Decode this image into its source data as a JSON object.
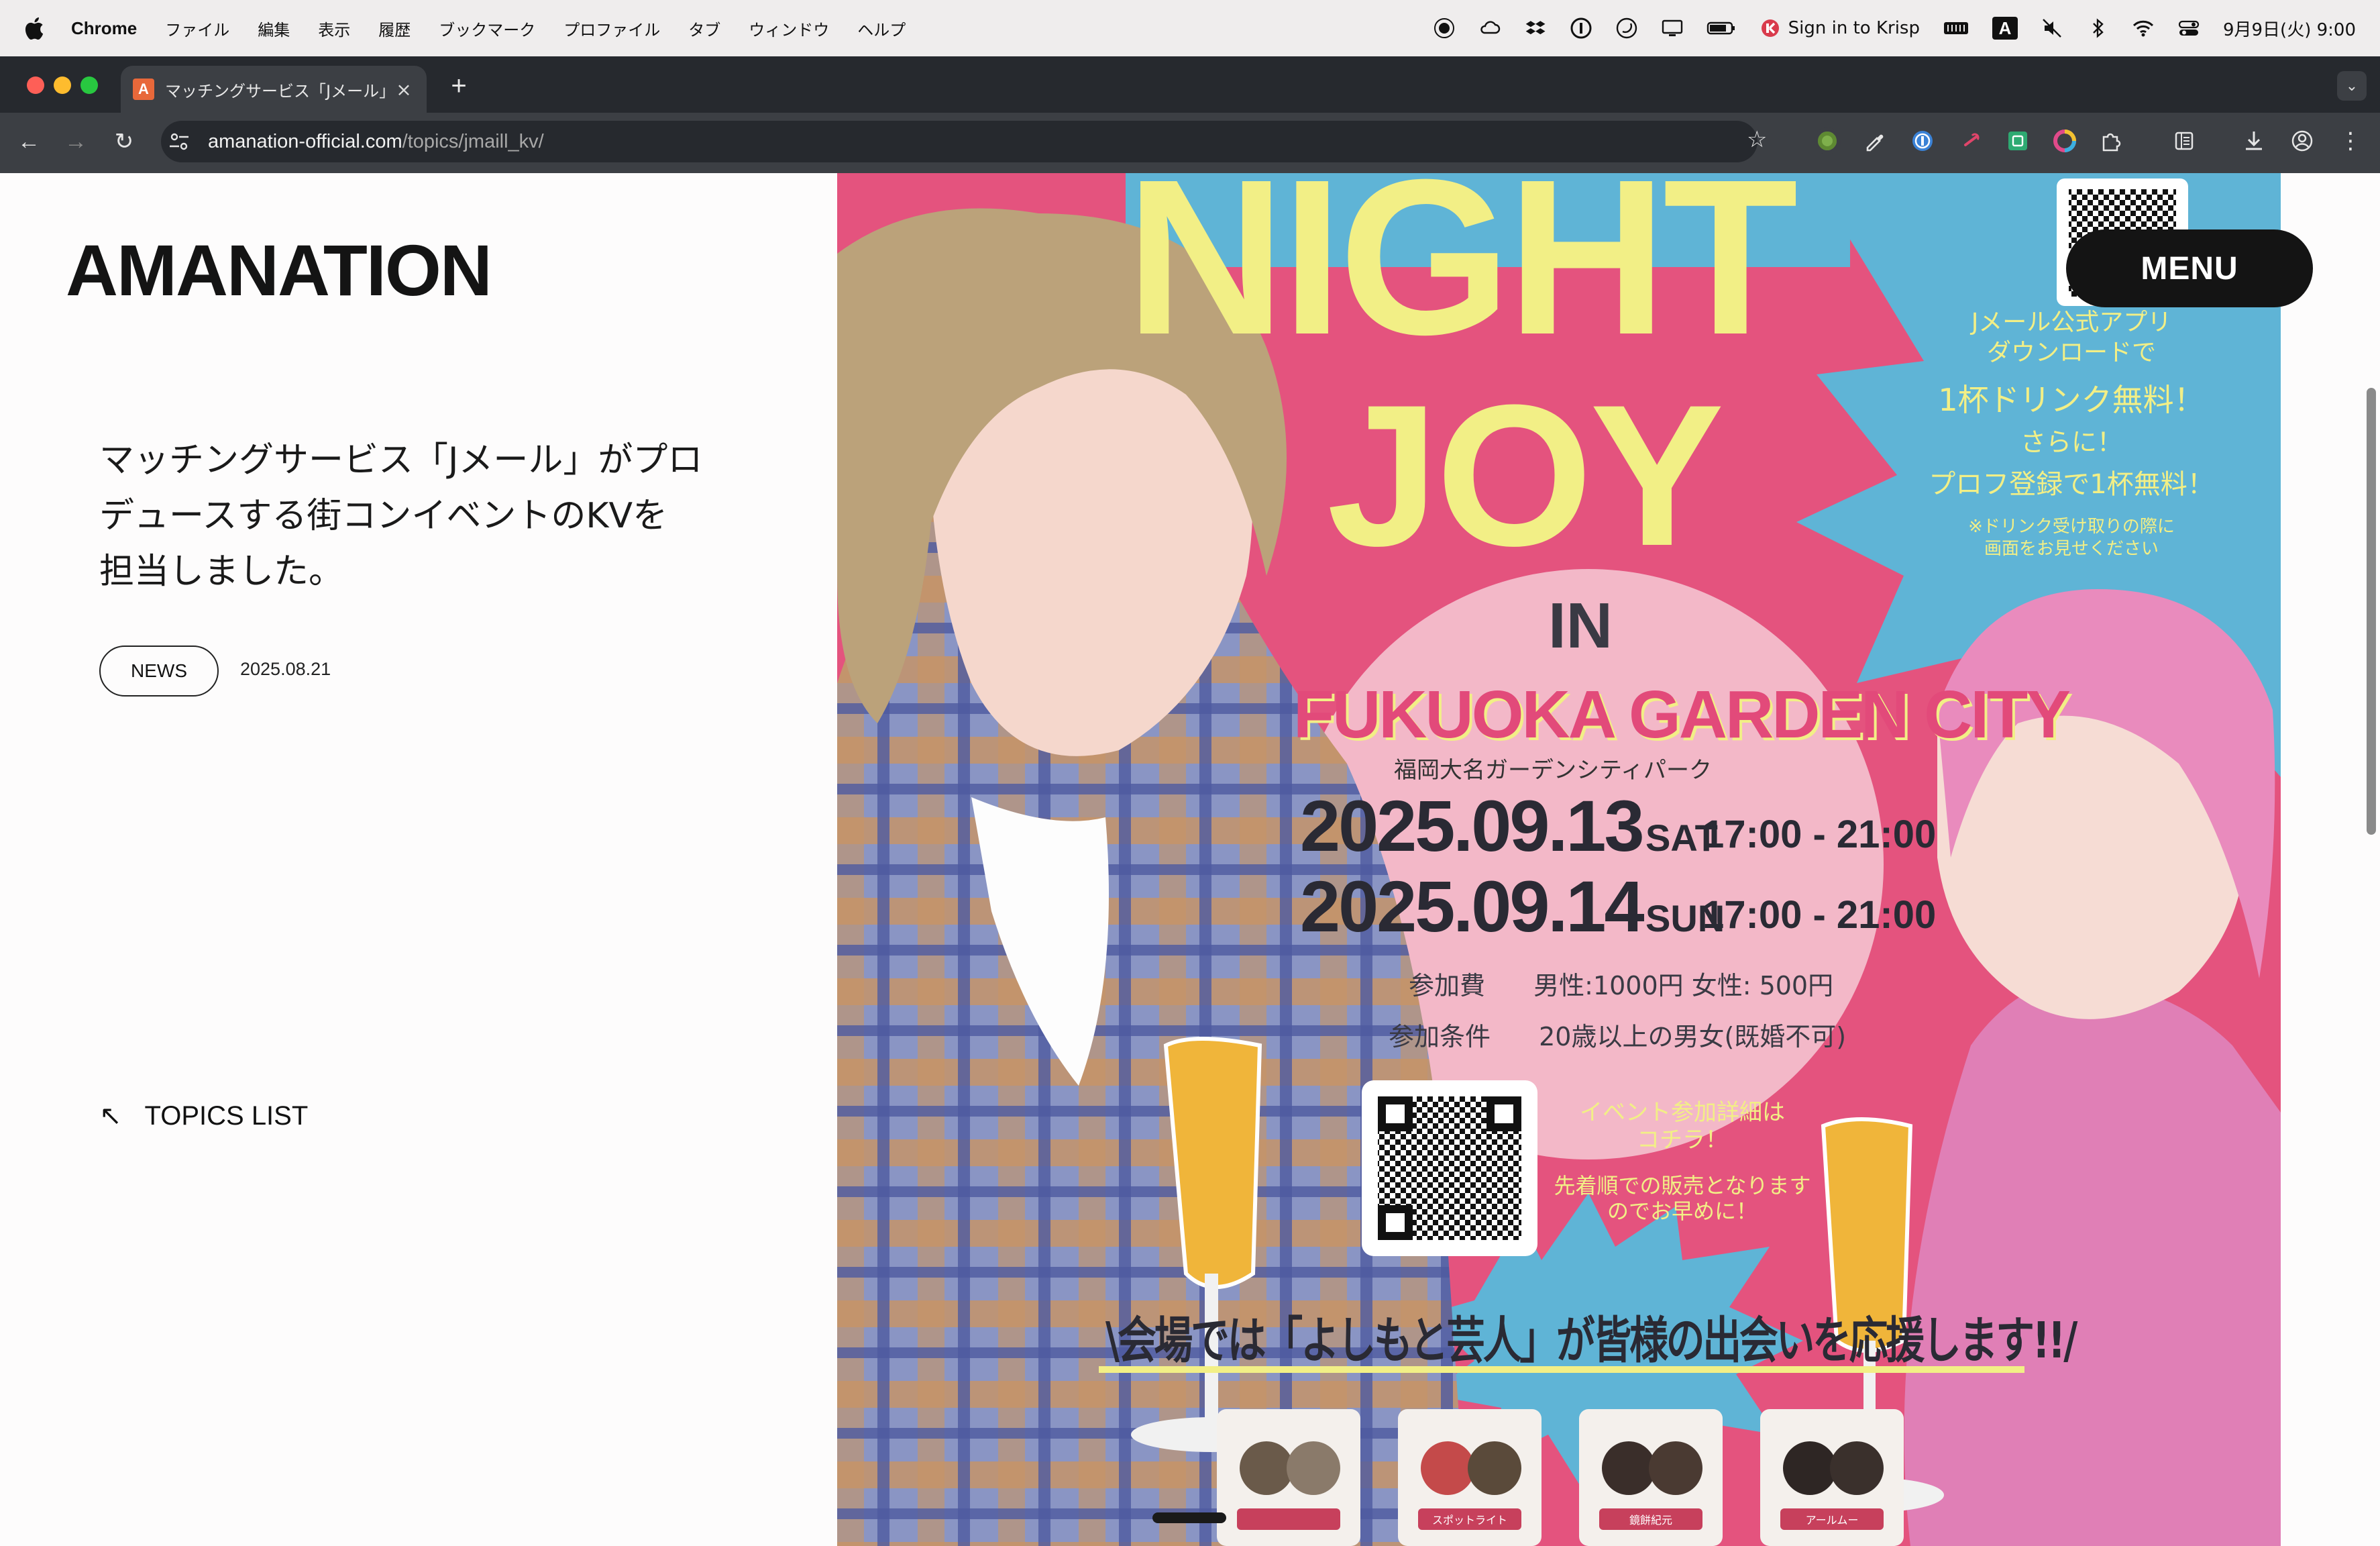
{
  "system_menubar": {
    "app_name": "Chrome",
    "menus": [
      "ファイル",
      "編集",
      "表示",
      "履歴",
      "ブックマーク",
      "プロファイル",
      "タブ",
      "ウィンドウ",
      "ヘルプ"
    ],
    "krisp_label": "Sign in to Krisp",
    "keyboard_indicator": "A",
    "clock": "9月9日(火) 9:00"
  },
  "browser": {
    "tab_title": "マッチングサービス「Jメール」/",
    "favicon_letter": "A",
    "url_host": "amanation-official.com",
    "url_path": "/topics/jmaill_kv/"
  },
  "page": {
    "logo": "AMANATION",
    "headline_lines": [
      "マッチングサービス「Jメール」がプロ",
      "デュースする街コンイベントのKVを",
      "担当しました。"
    ],
    "category_tag": "NEWS",
    "date": "2025.08.21",
    "topics_list_label": "TOPICS LIST",
    "menu_label": "MENU"
  },
  "poster": {
    "title_line1": "NIGHT",
    "title_line2": "JOY",
    "in_label": "IN",
    "venue_en": "FUKUOKA GARDEN CITY",
    "venue_ja": "福岡大名ガーデンシティパーク",
    "date1": "2025.09.13",
    "day1": "SAT",
    "date2": "2025.09.14",
    "day2": "SUN",
    "time": "17:00 - 21:00",
    "fee_label": "参加費",
    "fee_value": "男性:1000円  女性: 500円",
    "condition_label": "参加条件",
    "condition_value": "20歳以上の男女(既婚不可)",
    "promo_lines": [
      "Jメール公式アプリ",
      "ダウンロードで",
      "1杯ドリンク無料！",
      "さらに！",
      "プロフ登録で1杯無料！",
      "※ドリンク受け取りの際に",
      "画面をお見せください"
    ],
    "details_lines": [
      "イベント参加詳細は",
      "コチラ！",
      "先着順での販売となります",
      "のでお早めに！"
    ],
    "banner": "\\会場では「よしもと芸人」が皆様の出会いを応援します!!/",
    "performers": [
      "",
      "スポットライト",
      "鏡餅紀元",
      "アールムー"
    ],
    "colors": {
      "pink": "#e4537e",
      "sky": "#5fb4d6",
      "yellow": "#f2ef86",
      "circle": "#f3b8c8"
    }
  }
}
